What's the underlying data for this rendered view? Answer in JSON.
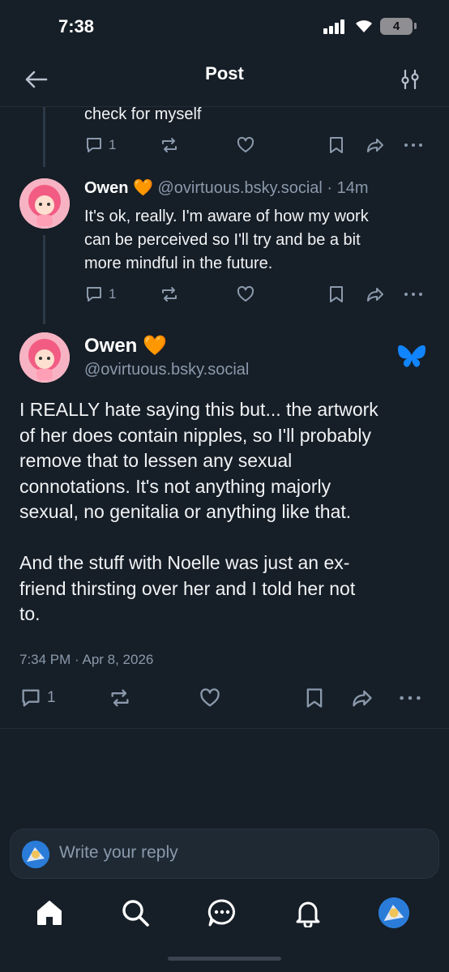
{
  "status_bar": {
    "time": "7:38",
    "battery": "4"
  },
  "header": {
    "title": "Post"
  },
  "thread": {
    "prev_post": {
      "text_tail": "check for myself",
      "reply_count": "1"
    },
    "reply": {
      "name": "Owen",
      "emoji": "🧡",
      "handle": "@ovirtuous.bsky.social",
      "age": "· 14m",
      "text_lines": [
        "It's ok, really. I'm aware of how my work",
        "can be perceived so I'll try and be a bit",
        "more mindful in the future."
      ],
      "reply_count": "1"
    }
  },
  "main_post": {
    "name": "Owen",
    "emoji": "🧡",
    "handle": "@ovirtuous.bsky.social",
    "text": "I REALLY hate saying this but... the artwork\nof her does contain nipples, so I'll probably\nremove that to lessen any sexual\nconnotations. It's not anything majorly\nsexual, no genitalia or anything like that.\n\nAnd the stuff with Noelle was just an ex-\nfriend thirsting over her and I told her not\nto.",
    "timestamp": "7:34 PM · Apr 8, 2026",
    "reply_count": "1"
  },
  "composer": {
    "placeholder": "Write your reply"
  },
  "colors": {
    "background": "#161e27",
    "muted": "#8a99ab",
    "accent": "#1185fe",
    "heart": "#ff9a1f"
  },
  "tabbar": {
    "icons": [
      "home-icon",
      "search-icon",
      "chat-icon",
      "bell-icon",
      "profile-avatar"
    ]
  }
}
